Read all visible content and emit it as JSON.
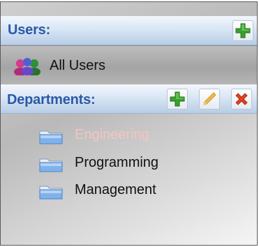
{
  "users_section": {
    "title": "Users:",
    "all_users_label": "All Users"
  },
  "departments_section": {
    "title": "Departments:",
    "items": [
      {
        "label": "Engineering",
        "selected": true
      },
      {
        "label": "Programming",
        "selected": false
      },
      {
        "label": "Management",
        "selected": false
      }
    ]
  },
  "icons": {
    "add": "plus-icon",
    "edit": "pencil-icon",
    "delete": "x-icon",
    "users": "users-group-icon",
    "folder": "folder-icon"
  },
  "colors": {
    "header_title": "#2a5aa8",
    "selected_text": "#f4c5c0",
    "add_green": "#3aa12c",
    "delete_red": "#e2401c"
  }
}
